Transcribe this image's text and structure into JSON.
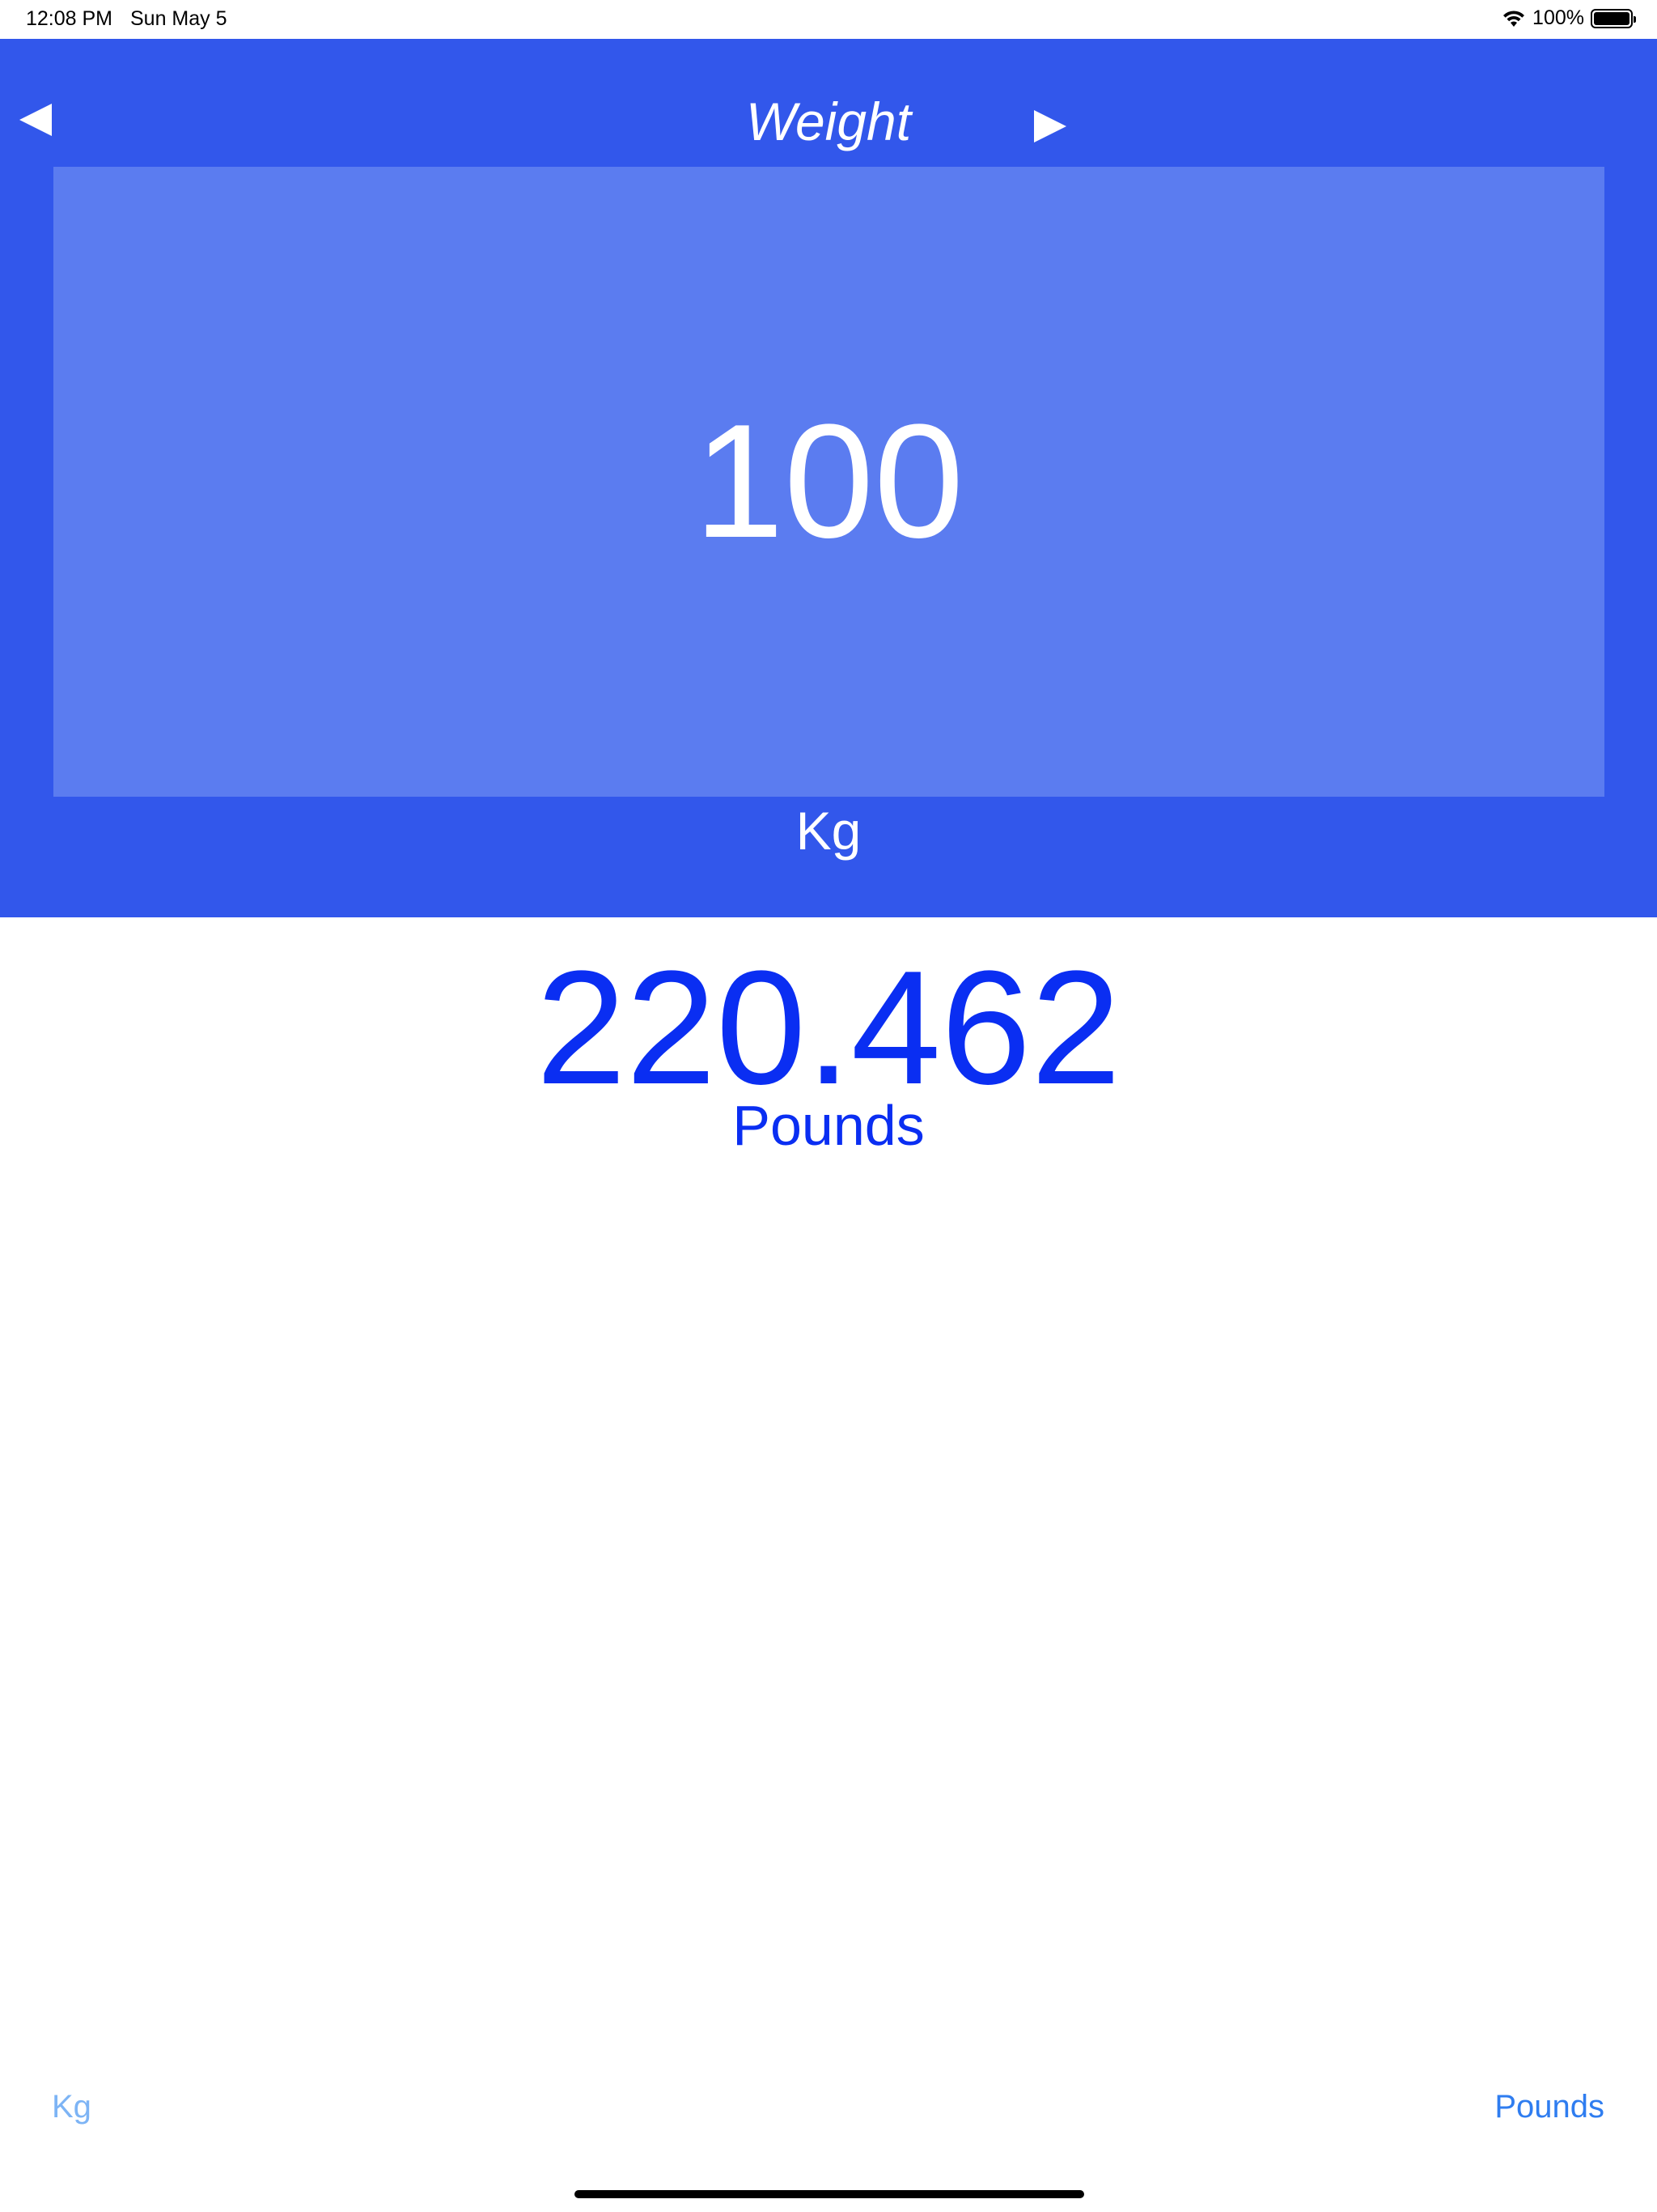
{
  "status_bar": {
    "time": "12:08 PM",
    "date": "Sun May 5",
    "battery_percent": "100%",
    "battery_level": 1.0,
    "wifi_icon": "wifi-icon"
  },
  "header": {
    "title": "Weight",
    "prev_icon": "triangle-left-icon",
    "next_icon": "triangle-right-icon"
  },
  "converter": {
    "input_value": "100",
    "from_unit": "Kg",
    "result_value": "220.462",
    "to_unit": "Pounds"
  },
  "bottom_bar": {
    "left_label": "Kg",
    "right_label": "Pounds"
  },
  "colors": {
    "header_bg": "#3257EB",
    "input_bg": "#5B7CF0",
    "result_text": "#0A2EF2",
    "tab_inactive": "#7DB4F5",
    "tab_active": "#2F7DF0"
  }
}
